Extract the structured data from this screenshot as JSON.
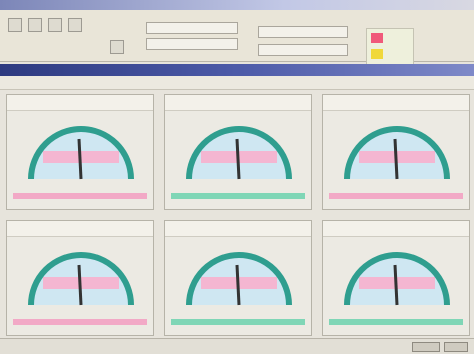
{
  "window": {
    "title": ""
  },
  "toolbar": {
    "icons": [
      "file-icon",
      "open-icon",
      "save-icon",
      "print-icon",
      "settings-icon"
    ],
    "fields": [
      "",
      "",
      "",
      ""
    ]
  },
  "gauges": [
    {
      "title": "",
      "band_color": "#f2a9c6"
    },
    {
      "title": "",
      "band_color": "#7fd6b6"
    },
    {
      "title": "",
      "band_color": "#f2a9c6"
    },
    {
      "title": "",
      "band_color": "#f2a9c6"
    },
    {
      "title": "",
      "band_color": "#7fd6b6"
    },
    {
      "title": "",
      "band_color": "#7fd6b6"
    }
  ],
  "colors": {
    "gauge_arc": "#2f9e8f",
    "gauge_fill": "#cfe7f2",
    "gauge_pink": "#f4b6d1",
    "needle": "#333333",
    "status_led_1": "#f05a7a",
    "status_led_2": "#f0d83a"
  }
}
